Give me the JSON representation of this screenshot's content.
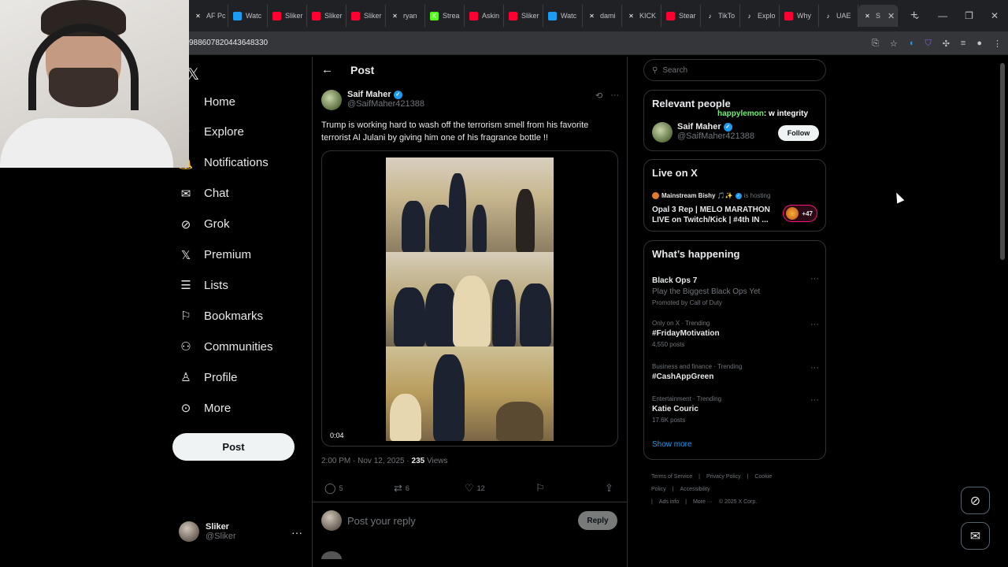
{
  "browser": {
    "tabs": [
      {
        "label": "AF Pc",
        "icon": "x-icon",
        "color": "#000000"
      },
      {
        "label": "Watc",
        "icon": "globe-icon",
        "color": "#1d9bf0"
      },
      {
        "label": "Sliker",
        "icon": "youtube-icon",
        "color": "#ff0033"
      },
      {
        "label": "Sliker",
        "icon": "youtube-icon",
        "color": "#ff0033"
      },
      {
        "label": "Sliker",
        "icon": "youtube-icon",
        "color": "#ff0033"
      },
      {
        "label": "ryan",
        "icon": "x-icon",
        "color": "#000000"
      },
      {
        "label": "Strea",
        "icon": "kick-icon",
        "color": "#53fc18"
      },
      {
        "label": "Askin",
        "icon": "youtube-icon",
        "color": "#ff0033"
      },
      {
        "label": "Sliker",
        "icon": "youtube-icon",
        "color": "#ff0033"
      },
      {
        "label": "Watc",
        "icon": "globe-icon",
        "color": "#1d9bf0"
      },
      {
        "label": "dami",
        "icon": "x-icon",
        "color": "#000000"
      },
      {
        "label": "KICK",
        "icon": "x-icon",
        "color": "#000000"
      },
      {
        "label": "Stear",
        "icon": "youtube-icon",
        "color": "#ff0033"
      },
      {
        "label": "TikTo",
        "icon": "tiktok-icon",
        "color": "#000000"
      },
      {
        "label": "Explo",
        "icon": "tiktok-icon",
        "color": "#000000"
      },
      {
        "label": "Why",
        "icon": "youtube-icon",
        "color": "#ff0033"
      },
      {
        "label": "UAE",
        "icon": "tiktok-icon",
        "color": "#000000"
      },
      {
        "label": "S",
        "icon": "x-icon",
        "color": "#000000",
        "active": true
      }
    ],
    "url": "988607820443648330"
  },
  "nav": {
    "items": [
      {
        "label": "Home",
        "icon": "home-icon",
        "glyph": "⌂"
      },
      {
        "label": "Explore",
        "icon": "search-icon",
        "glyph": "⚲"
      },
      {
        "label": "Notifications",
        "icon": "bell-icon",
        "glyph": "🔔"
      },
      {
        "label": "Chat",
        "icon": "mail-icon",
        "glyph": "✉"
      },
      {
        "label": "Grok",
        "icon": "grok-icon",
        "glyph": "⊘"
      },
      {
        "label": "Premium",
        "icon": "x-logo-icon",
        "glyph": "𝕏"
      },
      {
        "label": "Lists",
        "icon": "list-icon",
        "glyph": "☰"
      },
      {
        "label": "Bookmarks",
        "icon": "bookmark-icon",
        "glyph": "⚐"
      },
      {
        "label": "Communities",
        "icon": "communities-icon",
        "glyph": "⚇"
      },
      {
        "label": "Profile",
        "icon": "person-icon",
        "glyph": "♙"
      },
      {
        "label": "More",
        "icon": "more-circle-icon",
        "glyph": "⊙"
      }
    ],
    "post_label": "Post",
    "account": {
      "name": "Sliker",
      "handle": "@Sliker"
    }
  },
  "post": {
    "header": "Post",
    "author": {
      "name": "Saif Maher",
      "handle": "@SaifMaher421388"
    },
    "text": "Trump is working hard to wash off the terrorism smell from his favorite terrorist Al Julani by giving him one of his fragrance bottle !!",
    "video_time": "0:04",
    "time": "2:00 PM · Nov 12, 2025",
    "views": "235",
    "views_label": "Views",
    "replies": "5",
    "reposts": "6",
    "likes": "12",
    "reply_placeholder": "Post your reply",
    "reply_button": "Reply"
  },
  "sidebar": {
    "search_placeholder": "Search",
    "relevant": {
      "title": "Relevant people",
      "name": "Saif Maher",
      "handle": "@SaifMaher421388",
      "follow_label": "Follow"
    },
    "overlay_chat": {
      "user": "happylemon",
      "message": ": w integrity"
    },
    "live": {
      "title": "Live on X",
      "host": "Mainstream Bishy 🎵✨",
      "hosting": "is hosting",
      "stream_title": "Opal 3 Rep | MELO MARATHON LIVE on Twitch/Kick | #4th IN ...",
      "listeners": "+47"
    },
    "happening": {
      "title": "What’s happening",
      "trends": [
        {
          "context": "",
          "name": "Black Ops 7",
          "sub": "Play the Biggest Black Ops Yet",
          "count": "Promoted by Call of Duty"
        },
        {
          "context": "Only on X · Trending",
          "name": "#FridayMotivation",
          "sub": "",
          "count": "4,550 posts"
        },
        {
          "context": "Business and finance · Trending",
          "name": "#CashAppGreen",
          "sub": "",
          "count": ""
        },
        {
          "context": "Entertainment · Trending",
          "name": "Katie Couric",
          "sub": "",
          "count": "17.6K posts"
        }
      ],
      "show_more": "Show more"
    },
    "footer": [
      "Terms of Service",
      "|",
      "Privacy Policy",
      "|",
      "Cookie Policy",
      "|",
      "Accessibility",
      "|",
      "Ads info",
      "|",
      "More ···",
      "© 2025 X Corp."
    ]
  },
  "colors": {
    "accent": "#1d9bf0",
    "background": "#000000",
    "text": "#e7e9ea",
    "muted": "#71767b",
    "border": "#2f3336"
  }
}
